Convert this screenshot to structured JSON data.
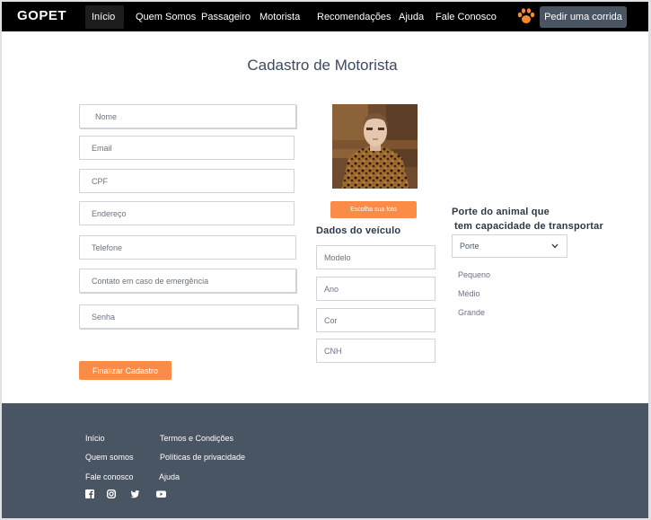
{
  "brand": "GOPET",
  "nav": {
    "items": [
      "Início",
      "Quem Somos",
      "Passageiro",
      "Motorista",
      "Recomendações",
      "Ajuda",
      "Fale Conosco"
    ],
    "ride_button": "Pedir uma corrida",
    "paw_icon": "paw-icon",
    "accent": "#f28a2e"
  },
  "page": {
    "title": "Cadastro de Motorista"
  },
  "form": {
    "placeholders": [
      "Nome",
      "Email",
      "CPF",
      "Endereço",
      "Telefone",
      "Contato em caso de emergência",
      "Senha"
    ],
    "submit_label": "Finalizar Cadastro"
  },
  "photo": {
    "button_label": "Escolha sua foto"
  },
  "vehicle": {
    "title": "Dados do veículo",
    "placeholders": [
      "Modelo",
      "Ano",
      "Cor",
      "CNH"
    ]
  },
  "animal_size": {
    "title_line1": "Porte do animal que",
    "title_line2": "tem capacidade de transportar",
    "select_value": "Porte",
    "options": [
      "Pequeno",
      "Médio",
      "Grande"
    ]
  },
  "footer": {
    "col1": [
      "Início",
      "Quem somos",
      "Fale conosco"
    ],
    "col2": [
      "Termos e Condições",
      "Políticas de privacidade",
      "Ajuda"
    ],
    "social_icons": [
      "facebook-icon",
      "instagram-icon",
      "twitter-icon",
      "youtube-icon"
    ]
  },
  "colors": {
    "navbar": "#000000",
    "footer": "#4a5563",
    "button": "#fb8c47",
    "ride_button": "#4a5563"
  }
}
